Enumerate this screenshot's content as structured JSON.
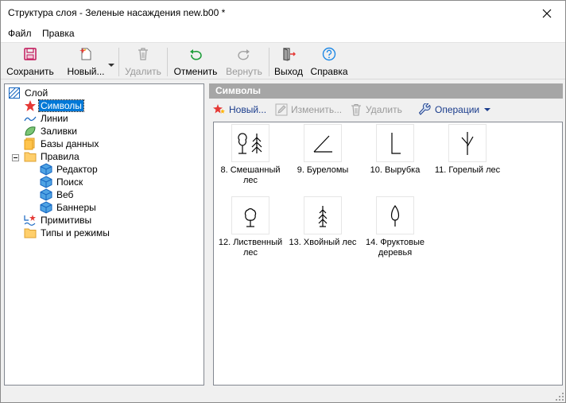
{
  "window": {
    "title": "Структура слоя - Зеленые насаждения new.b00 *",
    "close_icon": "close-icon"
  },
  "menu": {
    "file": "Файл",
    "edit": "Правка"
  },
  "toolbar": {
    "save": "Сохранить",
    "new": "Новый...",
    "delete": "Удалить",
    "undo": "Отменить",
    "redo": "Вернуть",
    "exit": "Выход",
    "help": "Справка"
  },
  "tree": {
    "root": "Слой",
    "symbols": "Символы",
    "lines": "Линии",
    "fills": "Заливки",
    "databases": "Базы данных",
    "rules": "Правила",
    "editor": "Редактор",
    "search": "Поиск",
    "web": "Веб",
    "banners": "Баннеры",
    "primitives": "Примитивы",
    "types_modes": "Типы и режимы"
  },
  "panel": {
    "header": "Символы",
    "new": "Новый...",
    "edit": "Изменить...",
    "delete": "Удалить",
    "operations": "Операции"
  },
  "symbols": [
    {
      "label": "8. Смешанный лес",
      "icon": "mixed-forest-icon"
    },
    {
      "label": "9. Буреломы",
      "icon": "windfall-icon"
    },
    {
      "label": "10. Вырубка",
      "icon": "clearcut-icon"
    },
    {
      "label": "11. Горелый лес",
      "icon": "burnt-forest-icon"
    },
    {
      "label": "12. Лиственный лес",
      "icon": "deciduous-tree-icon"
    },
    {
      "label": "13. Хвойный лес",
      "icon": "conifer-tree-icon"
    },
    {
      "label": "14. Фруктовые деревья",
      "icon": "fruit-tree-icon"
    }
  ],
  "colors": {
    "selection": "#0078d7",
    "panel_header": "#a6a6a6",
    "link_text": "#1a3c8c",
    "save_icon": "#c2185b",
    "undo_icon": "#1e9e3a",
    "help_icon": "#1e88e5"
  }
}
